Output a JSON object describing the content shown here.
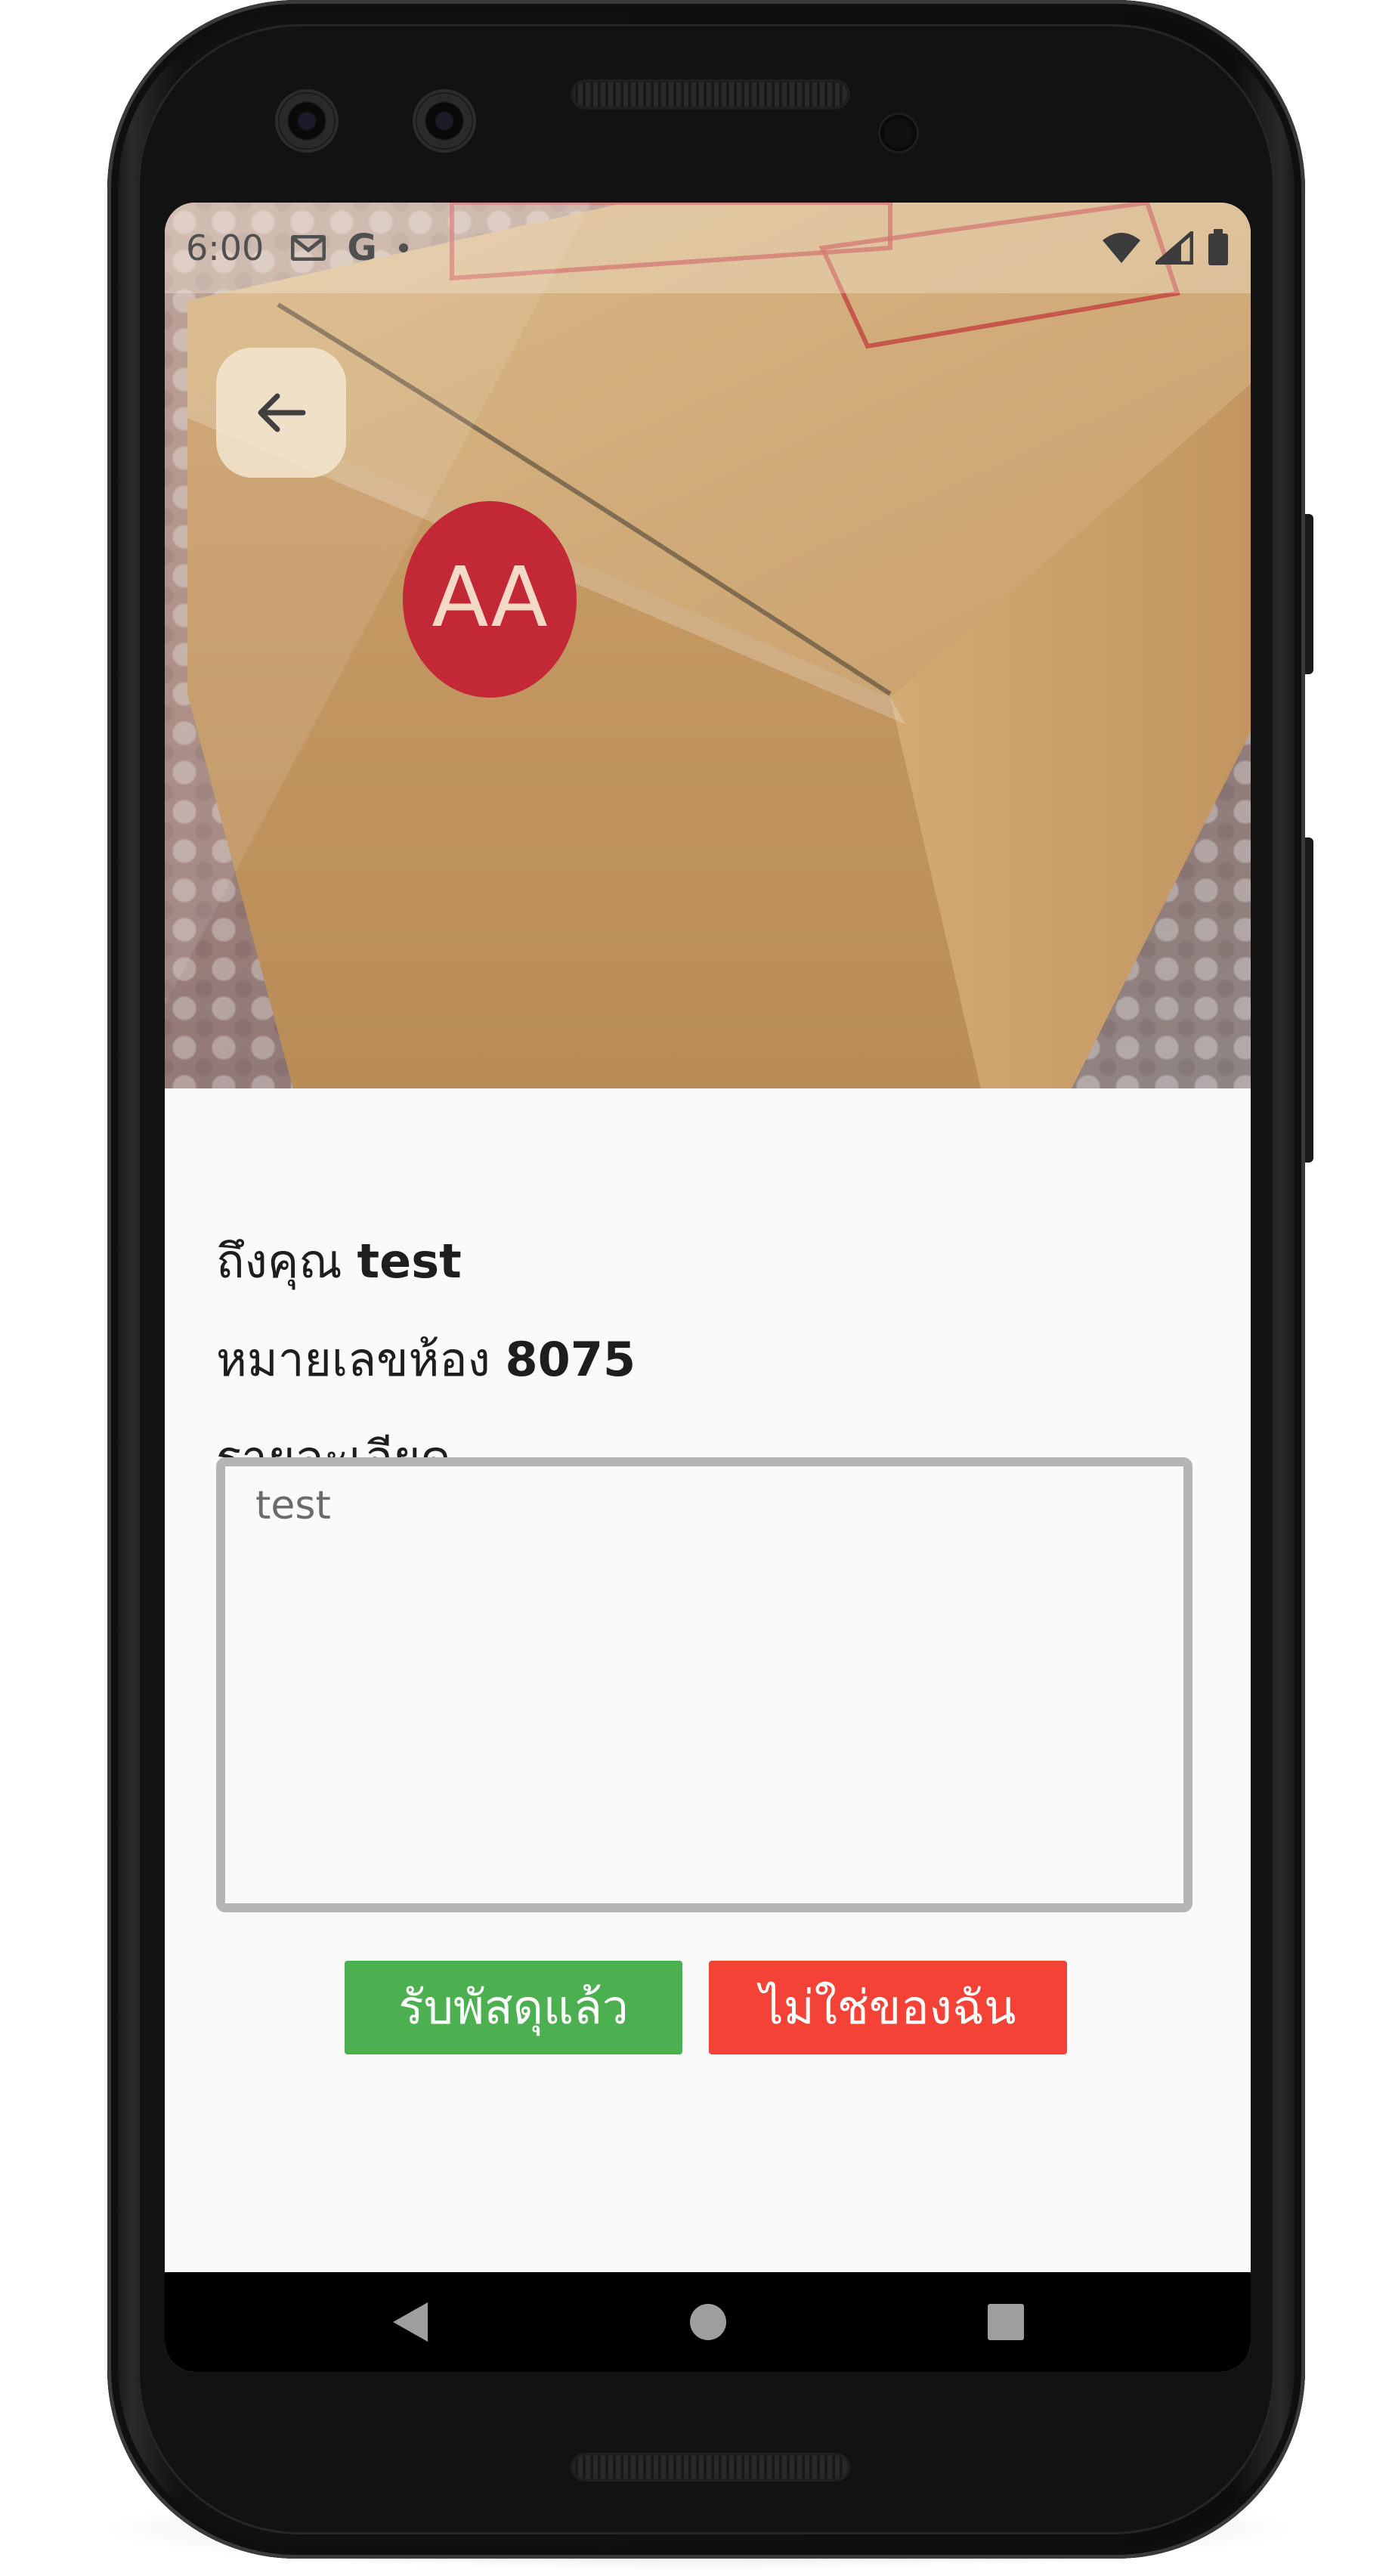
{
  "status_bar": {
    "time": "6:00",
    "icons_left": [
      "gmail-icon",
      "google-icon",
      "notification-dot-icon"
    ],
    "icons_right": [
      "wifi-icon",
      "cell-signal-icon",
      "battery-icon"
    ],
    "google_glyph": "G"
  },
  "header": {
    "back_icon": "arrow-back-icon",
    "image_description": "cardboard parcel box on bubble wrap",
    "sticker_text": "AA"
  },
  "parcel": {
    "recipient_prefix": "ถึงคุณ",
    "recipient_name": "test",
    "room_prefix": "หมายเลขห้อง",
    "room_number": "8075",
    "details_label": "รายละเอียด",
    "details_value": "test"
  },
  "actions": {
    "received_label": "รับพัสดุแล้ว",
    "not_mine_label": "ไม่ใช่ของฉัน"
  },
  "nav_bar": {
    "icons": [
      "nav-back-icon",
      "nav-home-icon",
      "nav-recents-icon"
    ]
  },
  "colors": {
    "received_button": "#4caf50",
    "not_mine_button": "#f44336",
    "text": "#1e1e1e",
    "details_border": "#b5b5b5"
  }
}
